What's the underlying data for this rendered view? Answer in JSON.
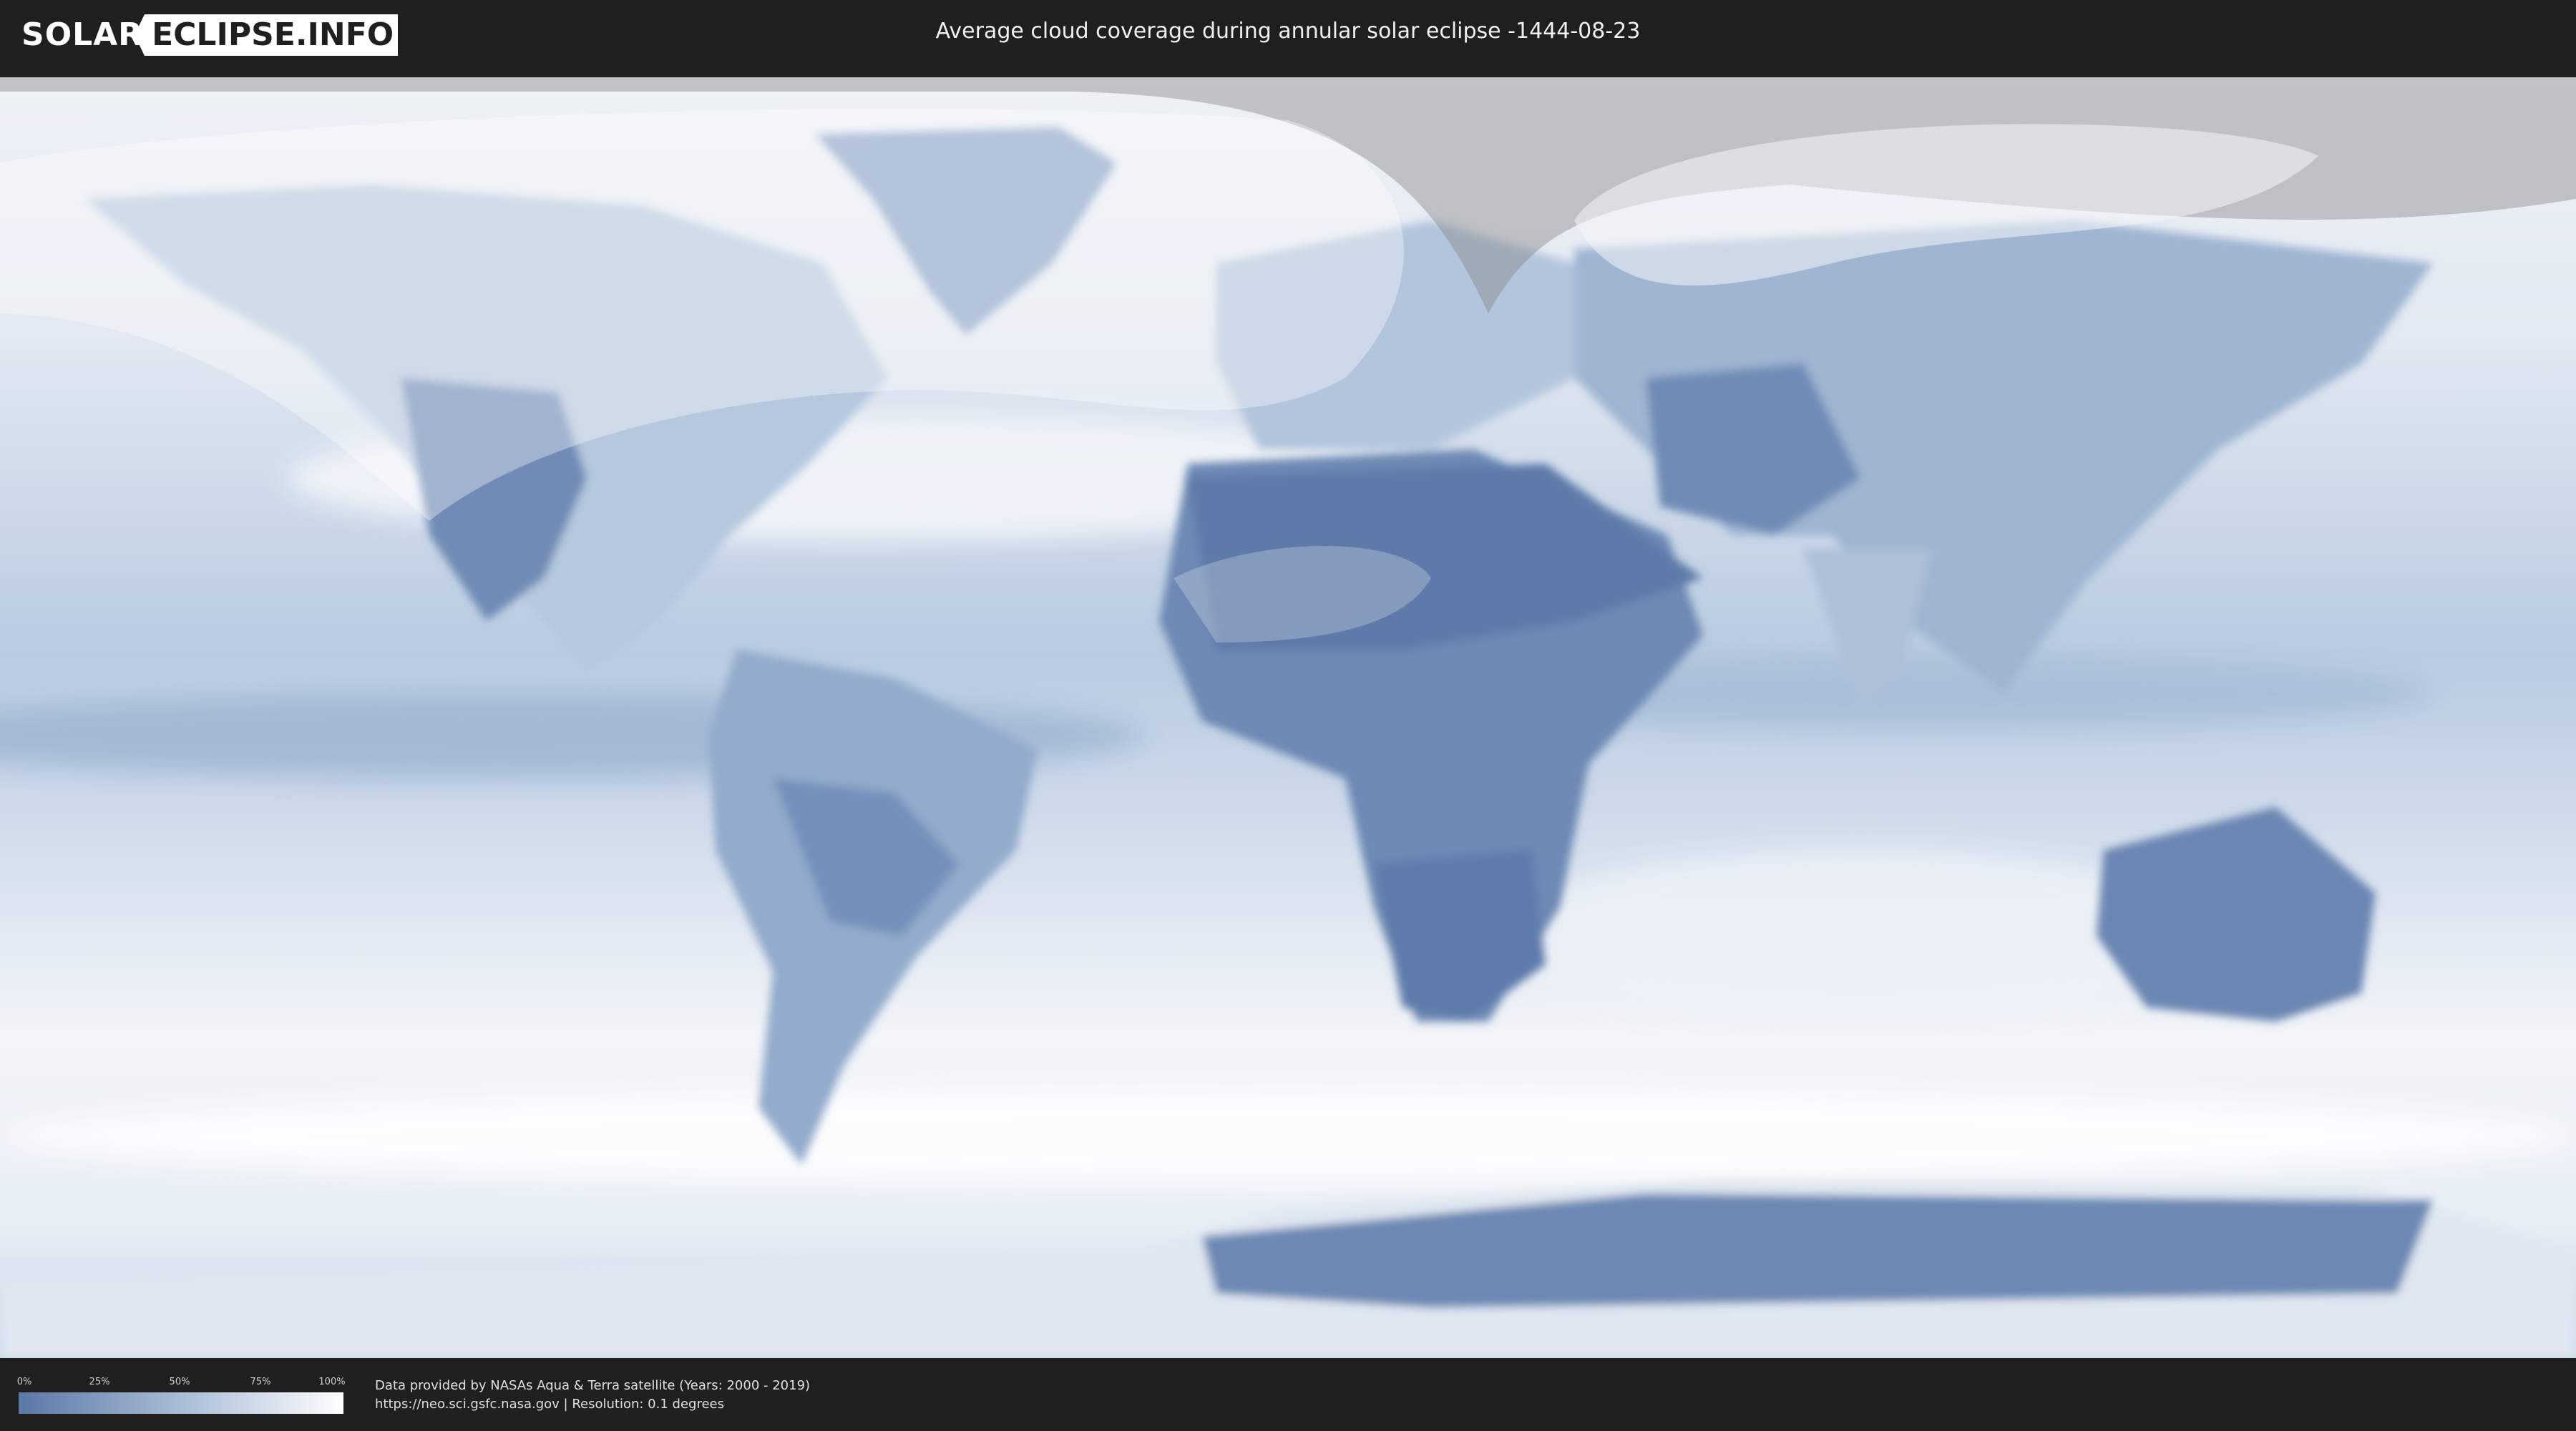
{
  "header": {
    "logo_part1": "SOLAR",
    "logo_part2": "ECLIPSE.INFO",
    "title": "Average cloud coverage during annular solar eclipse -1444-08-23"
  },
  "legend": {
    "ticks": [
      "0%",
      "25%",
      "50%",
      "75%",
      "100%"
    ],
    "color_low": "#5b77a6",
    "color_high": "#ffffff"
  },
  "footer": {
    "credit_line1": "Data provided by NASAs Aqua & Terra satellite (Years: 2000 - 2019)",
    "credit_line2": "https://neo.sci.gsfc.nasa.gov | Resolution: 0.1 degrees"
  },
  "map": {
    "projection": "equirectangular",
    "layer": "average cloud coverage",
    "colors": {
      "clear_land": "#5d7aa8",
      "cloudy": "#f4f7fb",
      "night_overlay": "#8a8a8a"
    }
  }
}
